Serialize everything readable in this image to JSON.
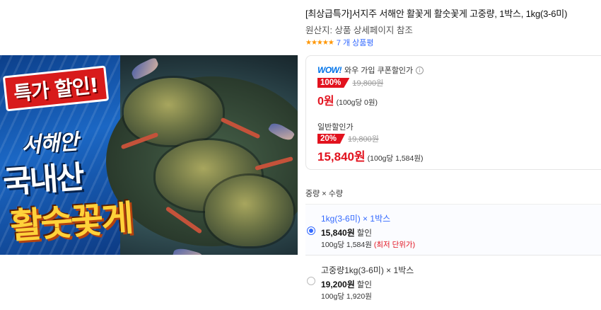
{
  "image": {
    "badge_sale": "특가 할인!",
    "text_region": "서해안",
    "text_domestic": "국내산",
    "text_crab": "활숫꽃게"
  },
  "product": {
    "title": "[최상급특가]서지주 서해안 활꽃게 활숫꽃게 고중량, 1박스, 1kg(3-6미)",
    "origin": "원산지: 상품 상세페이지 참조",
    "stars": "★★★★★",
    "rating_value": 5,
    "review_count": "7 개 상품평"
  },
  "wow": {
    "logo": "WOW!",
    "label": "와우 가입 쿠폰할인가",
    "info_icon": "i",
    "discount": "100%",
    "original_price": "19,800원",
    "price": "0원",
    "unit_price": "(100g당 0원)"
  },
  "general": {
    "label": "일반할인가",
    "discount": "20%",
    "original_price": "19,800원",
    "price": "15,840원",
    "unit_price": "(100g당 1,584원)"
  },
  "options_header": "중량 × 수량",
  "options": [
    {
      "name": "1kg(3-6미) × 1박스",
      "price": "15,840원",
      "price_suffix": "할인",
      "unit_price": "100g당 1,584원",
      "note": "(최저 단위가)",
      "selected": true
    },
    {
      "name": "고중량1kg(3-6미) × 1박스",
      "price": "19,200원",
      "price_suffix": "할인",
      "unit_price": "100g당 1,920원",
      "note": "",
      "selected": false
    }
  ],
  "colors": {
    "accent_blue": "#346aff",
    "sale_red": "#e2121e",
    "star_orange": "#ff9600"
  }
}
